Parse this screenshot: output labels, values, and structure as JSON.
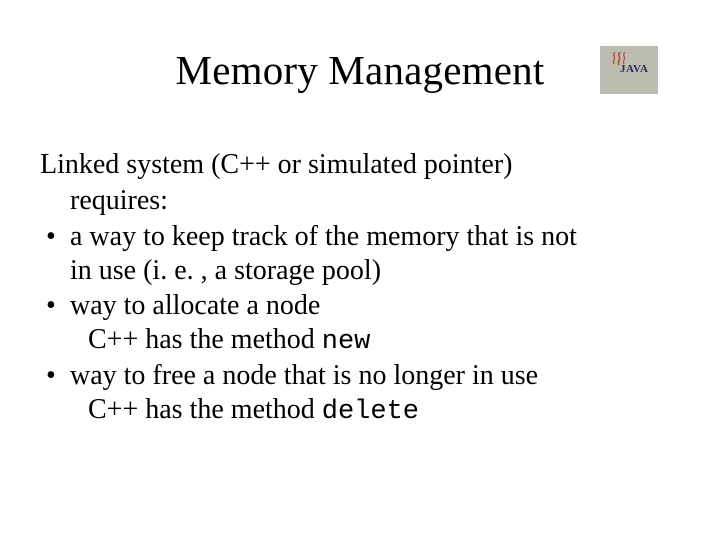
{
  "title": "Memory Management",
  "logo": {
    "text": "JAVA",
    "name": "java-logo"
  },
  "intro_line1": "Linked system (C++ or simulated pointer)",
  "intro_line2": "requires:",
  "bullets": [
    {
      "text_a": "a way to keep track of the memory that is not",
      "text_b": "in use (i. e. , a storage pool)"
    },
    {
      "text_a": "way to allocate a node",
      "sub_prefix": "C++ has the method ",
      "sub_keyword": "new"
    },
    {
      "text_a": "way to free a node that is no longer in use",
      "sub_prefix": "C++ has the method ",
      "sub_keyword": "delete"
    }
  ],
  "bullet_char": "•"
}
